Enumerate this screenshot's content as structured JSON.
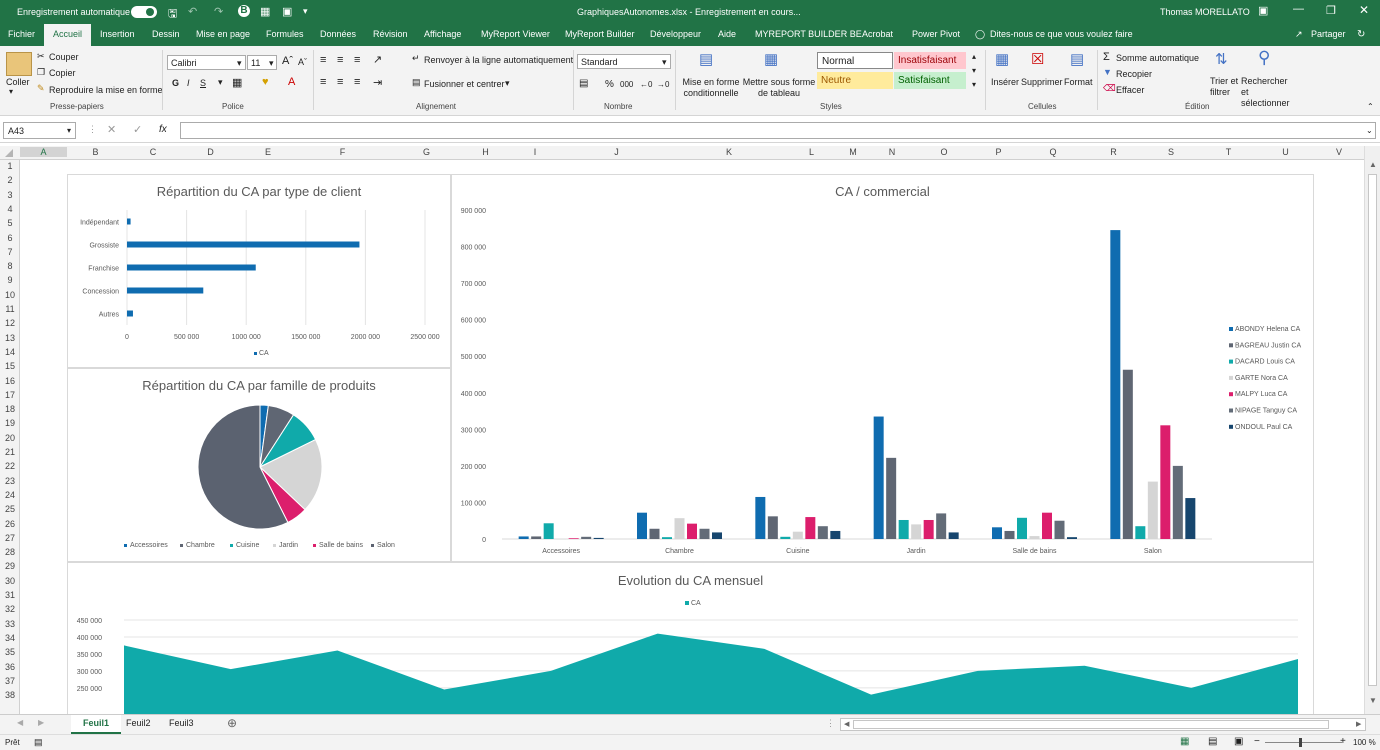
{
  "titlebar": {
    "autosave_label": "Enregistrement automatique",
    "toggle_state": "on",
    "doc_title": "GraphiquesAutonomes.xlsx  -  Enregistrement en cours...",
    "user": "Thomas MORELLATO"
  },
  "tabs": [
    "Fichier",
    "Accueil",
    "Insertion",
    "Dessin",
    "Mise en page",
    "Formules",
    "Données",
    "Révision",
    "Affichage",
    "MyReport Viewer",
    "MyReport Builder",
    "Développeur",
    "Aide",
    "MYREPORT BUILDER BE",
    "Acrobat",
    "Power Pivot"
  ],
  "active_tab": "Accueil",
  "tell_me": "Dites-nous ce que vous voulez faire",
  "share": "Partager",
  "ribbon": {
    "clipboard": {
      "paste": "Coller",
      "cut": "Couper",
      "copy": "Copier",
      "format_painter": "Reproduire la mise en forme",
      "group": "Presse-papiers"
    },
    "font": {
      "name": "Calibri",
      "size": "11",
      "group": "Police",
      "bold": "G",
      "italic": "I",
      "underline": "S"
    },
    "alignment": {
      "wrap": "Renvoyer à la ligne automatiquement",
      "merge": "Fusionner et centrer",
      "group": "Alignement"
    },
    "number": {
      "format": "Standard",
      "percent": "%",
      "thousands": "000",
      "group": "Nombre"
    },
    "styles": {
      "conditional": "Mise en forme conditionnelle",
      "table": "Mettre sous forme de tableau",
      "normal": "Normal",
      "bad": "Insatisfaisant",
      "neutral": "Neutre",
      "good": "Satisfaisant",
      "group": "Styles"
    },
    "cells": {
      "insert": "Insérer",
      "delete": "Supprimer",
      "format": "Format",
      "group": "Cellules"
    },
    "editing": {
      "autosum": "Somme automatique",
      "fill": "Recopier",
      "clear": "Effacer",
      "sort": "Trier et filtrer",
      "find": "Rechercher et sélectionner",
      "group": "Édition"
    }
  },
  "formula_bar": {
    "name_box": "A43",
    "fx": "fx",
    "value": ""
  },
  "columns": [
    "A",
    "B",
    "C",
    "D",
    "E",
    "F",
    "G",
    "H",
    "I",
    "J",
    "K",
    "L",
    "M",
    "N",
    "O",
    "P",
    "Q",
    "R",
    "S",
    "T",
    "U",
    "V"
  ],
  "rows": [
    "1",
    "2",
    "3",
    "4",
    "5",
    "6",
    "7",
    "8",
    "9",
    "10",
    "11",
    "12",
    "13",
    "14",
    "15",
    "16",
    "17",
    "18",
    "19",
    "20",
    "21",
    "22",
    "23",
    "24",
    "25",
    "26",
    "27",
    "28",
    "29",
    "30",
    "31",
    "32",
    "33",
    "34",
    "35",
    "36",
    "37",
    "38"
  ],
  "sheets": [
    "Feuil1",
    "Feuil2",
    "Feuil3"
  ],
  "active_sheet": "Feuil1",
  "status": {
    "ready": "Prêt",
    "zoom": "100 %"
  },
  "colors": {
    "excel_green": "#217346",
    "blue": "#0f6cb0",
    "gray": "#5f6673",
    "teal": "#10aaaa",
    "light": "#d5d5d5",
    "pink": "#dc1e6c",
    "darkgray": "#636c78",
    "navy": "#17466e"
  },
  "chart_data": [
    {
      "type": "bar",
      "orientation": "horizontal",
      "title": "Répartition du CA par type de client",
      "categories": [
        "Indépendant",
        "Grossiste",
        "Franchise",
        "Concession",
        "Autres"
      ],
      "values": [
        30000,
        1950000,
        1080000,
        640000,
        50000
      ],
      "series": [
        {
          "name": "CA",
          "values": [
            30000,
            1950000,
            1080000,
            640000,
            50000
          ]
        }
      ],
      "xlim": [
        0,
        2500000
      ],
      "ticks": [
        "0",
        "500 000",
        "1000 000",
        "1500 000",
        "2000 000",
        "2500 000"
      ],
      "grid": true,
      "legend": "bottom"
    },
    {
      "type": "pie",
      "title": "Répartition du CA par famille de produits",
      "categories": [
        "Accessoires",
        "Chambre",
        "Cuisine",
        "Jardin",
        "Salle de bains",
        "Salon"
      ],
      "values": [
        90000,
        290000,
        360000,
        810000,
        230000,
        2400000
      ],
      "colors": [
        "#0f6cb0",
        "#5f6673",
        "#10aaaa",
        "#d5d5d5",
        "#dc1e6c",
        "#5b6270"
      ],
      "legend": "bottom"
    },
    {
      "type": "bar",
      "title": "CA / commercial",
      "categories": [
        "Accessoires",
        "Chambre",
        "Cuisine",
        "Jardin",
        "Salle de bains",
        "Salon"
      ],
      "series": [
        {
          "name": "ABONDY Helena CA",
          "values": [
            7000,
            72000,
            115000,
            335000,
            32000,
            845000
          ]
        },
        {
          "name": "BAGREAU Justin CA",
          "values": [
            7000,
            28000,
            62000,
            222000,
            22000,
            463000
          ]
        },
        {
          "name": "DACARD Louis CA",
          "values": [
            43000,
            5000,
            6000,
            52000,
            58000,
            35000
          ]
        },
        {
          "name": "GARTE Nora CA",
          "values": [
            0,
            57000,
            20000,
            40000,
            8000,
            157000
          ]
        },
        {
          "name": "MALPY Luca CA",
          "values": [
            2000,
            42000,
            60000,
            52000,
            72000,
            311000
          ]
        },
        {
          "name": "NIPAGE Tanguy CA",
          "values": [
            6000,
            28000,
            35000,
            70000,
            50000,
            200000
          ]
        },
        {
          "name": "ONDOUL Paul CA",
          "values": [
            3000,
            18000,
            22000,
            18000,
            5000,
            112000
          ]
        }
      ],
      "ylim": [
        0,
        900000
      ],
      "ticks": [
        "0",
        "100 000",
        "200 000",
        "300 000",
        "400 000",
        "500 000",
        "600 000",
        "700 000",
        "800 000",
        "900 000"
      ],
      "legend": "right"
    },
    {
      "type": "area",
      "title": "Evolution du CA mensuel",
      "series": [
        {
          "name": "CA",
          "values": [
            375000,
            305000,
            360000,
            245000,
            300000,
            410000,
            365000,
            230000,
            300000,
            315000,
            250000,
            335000
          ]
        }
      ],
      "ticks": [
        "250 000",
        "300 000",
        "350 000",
        "400 000",
        "450 000"
      ],
      "ylim": [
        220000,
        450000
      ],
      "legend": "top"
    }
  ]
}
